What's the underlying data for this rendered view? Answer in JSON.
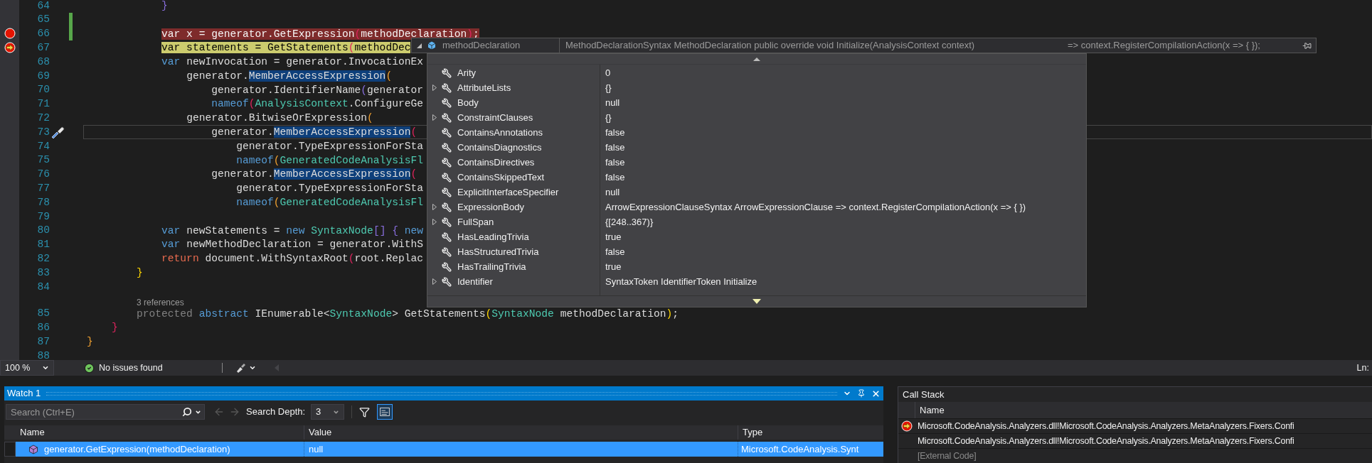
{
  "editor": {
    "lines": [
      {
        "kind": "code",
        "n": "64",
        "changed": false,
        "active": false,
        "tokens": [
          {
            "text": "            }",
            "kind": "b-purple"
          }
        ]
      },
      {
        "kind": "code",
        "n": "65",
        "changed": true,
        "active": false
      },
      {
        "kind": "code",
        "n": "66",
        "changed": true,
        "active": false,
        "glyph": {
          "kind": "breakpoint"
        },
        "tokens": [
          {
            "text": "            var x = generator.GetExpression",
            "kind": "id"
          },
          {
            "text": "(",
            "kind": "b-red"
          },
          {
            "text": "methodDeclaration",
            "kind": "id"
          },
          {
            "text": ")",
            "kind": "b-red"
          },
          {
            "text": ";",
            "kind": "id"
          }
        ]
      },
      {
        "kind": "code",
        "n": "67",
        "changed": false,
        "active": false,
        "glyph": {
          "kind": "current"
        },
        "tokens": [
          {
            "text": "            var statements = GetStatements",
            "kind": "id"
          },
          {
            "text": "(",
            "kind": "b-red"
          },
          {
            "text": "methodDec",
            "kind": "id"
          }
        ]
      },
      {
        "kind": "code",
        "n": "68",
        "changed": false,
        "active": false,
        "tokens": [
          {
            "text": "            var",
            "kind": "kw"
          },
          {
            "text": " newInvocation = generator.InvocationEx",
            "kind": "id"
          }
        ]
      },
      {
        "kind": "code",
        "n": "69",
        "changed": false,
        "active": false,
        "tokens": [
          {
            "text": "                generator.",
            "kind": "id"
          },
          {
            "text": "MemberAccessExpression",
            "kind": "ref"
          },
          {
            "text": "(",
            "kind": "b-orange"
          }
        ]
      },
      {
        "kind": "code",
        "n": "70",
        "changed": false,
        "active": false,
        "tokens": [
          {
            "text": "                    generator.IdentifierName",
            "kind": "id"
          },
          {
            "text": "(",
            "kind": "b-purple"
          },
          {
            "text": "generator",
            "kind": "id"
          }
        ]
      },
      {
        "kind": "code",
        "n": "71",
        "changed": false,
        "active": false,
        "tokens": [
          {
            "text": "                    nameof",
            "kind": "kw"
          },
          {
            "text": "(",
            "kind": "b-red"
          },
          {
            "text": "AnalysisContext",
            "kind": "type"
          },
          {
            "text": ".ConfigureGe",
            "kind": "id"
          }
        ]
      },
      {
        "kind": "code",
        "n": "72",
        "changed": false,
        "active": false,
        "tokens": [
          {
            "text": "                generator.BitwiseOrExpression",
            "kind": "id"
          },
          {
            "text": "(",
            "kind": "b-orange"
          }
        ]
      },
      {
        "kind": "code",
        "n": "73",
        "changed": false,
        "active": true,
        "glyph": {
          "kind": "quick-action"
        },
        "tokens": [
          {
            "text": "                    generator.",
            "kind": "id"
          },
          {
            "text": "MemberAccessExpression",
            "kind": "ref"
          },
          {
            "text": "(",
            "kind": "b-red"
          }
        ]
      },
      {
        "kind": "code",
        "n": "74",
        "changed": false,
        "active": false,
        "tokens": [
          {
            "text": "                        generator.TypeExpressionForSta",
            "kind": "id"
          }
        ]
      },
      {
        "kind": "code",
        "n": "75",
        "changed": false,
        "active": false,
        "tokens": [
          {
            "text": "                        nameof",
            "kind": "kw"
          },
          {
            "text": "(",
            "kind": "b-orange"
          },
          {
            "text": "GeneratedCodeAnalysisFl",
            "kind": "type"
          }
        ]
      },
      {
        "kind": "code",
        "n": "76",
        "changed": false,
        "active": false,
        "tokens": [
          {
            "text": "                    generator.",
            "kind": "id"
          },
          {
            "text": "MemberAccessExpression",
            "kind": "ref"
          },
          {
            "text": "(",
            "kind": "b-red"
          }
        ]
      },
      {
        "kind": "code",
        "n": "77",
        "changed": false,
        "active": false,
        "tokens": [
          {
            "text": "                        generator.TypeExpressionForSta",
            "kind": "id"
          }
        ]
      },
      {
        "kind": "code",
        "n": "78",
        "changed": false,
        "active": false,
        "tokens": [
          {
            "text": "                        nameof",
            "kind": "kw"
          },
          {
            "text": "(",
            "kind": "b-orange"
          },
          {
            "text": "GeneratedCodeAnalysisFl",
            "kind": "type"
          }
        ]
      },
      {
        "kind": "code",
        "n": "79",
        "changed": false,
        "active": false
      },
      {
        "kind": "code",
        "n": "80",
        "changed": false,
        "active": false,
        "tokens": [
          {
            "text": "            var",
            "kind": "kw"
          },
          {
            "text": " newStatements = ",
            "kind": "id"
          },
          {
            "text": "new",
            "kind": "kw"
          },
          {
            "text": " SyntaxNode",
            "kind": "type"
          },
          {
            "text": "[]",
            "kind": "b-purple"
          },
          {
            "text": " {",
            "kind": "b-purple"
          },
          {
            "text": " new",
            "kind": "kw"
          }
        ]
      },
      {
        "kind": "code",
        "n": "81",
        "changed": false,
        "active": false,
        "tokens": [
          {
            "text": "            var",
            "kind": "kw"
          },
          {
            "text": " newMethodDeclaration = generator.WithS",
            "kind": "id"
          }
        ]
      },
      {
        "kind": "code",
        "n": "82",
        "changed": false,
        "active": false,
        "tokens": [
          {
            "text": "            return",
            "kind": "ctl"
          },
          {
            "text": " document.WithSyntaxRoot",
            "kind": "id"
          },
          {
            "text": "(",
            "kind": "b-red"
          },
          {
            "text": "root.Replac",
            "kind": "id"
          }
        ]
      },
      {
        "kind": "code",
        "n": "83",
        "changed": false,
        "active": false,
        "tokens": [
          {
            "text": "        }",
            "kind": "b-gold"
          }
        ]
      },
      {
        "kind": "code",
        "n": "84",
        "changed": false,
        "active": false
      },
      {
        "kind": "codelens",
        "text": "3 references"
      },
      {
        "kind": "code",
        "n": "85",
        "changed": false,
        "active": false,
        "tokens": [
          {
            "text": "        protected",
            "kind": "dim"
          },
          {
            "text": " abstract",
            "kind": "kw"
          },
          {
            "text": " IEnumerable<",
            "kind": "id"
          },
          {
            "text": "SyntaxNode",
            "kind": "type"
          },
          {
            "text": "> GetStatements",
            "kind": "id"
          },
          {
            "text": "(",
            "kind": "b-gold"
          },
          {
            "text": "SyntaxNode",
            "kind": "type"
          },
          {
            "text": " methodDeclaration",
            "kind": "id"
          },
          {
            "text": ")",
            "kind": "b-gold"
          },
          {
            "text": ";",
            "kind": "id"
          }
        ]
      },
      {
        "kind": "code",
        "n": "86",
        "changed": false,
        "active": false,
        "tokens": [
          {
            "text": "    }",
            "kind": "b-red"
          }
        ]
      },
      {
        "kind": "code",
        "n": "87",
        "changed": false,
        "active": false,
        "tokens": [
          {
            "text": "}",
            "kind": "b-orange"
          }
        ]
      },
      {
        "kind": "code",
        "n": "88",
        "changed": false,
        "active": false
      }
    ]
  },
  "datatip": {
    "expanded": true,
    "name": "methodDeclaration",
    "value": "MethodDeclarationSyntax MethodDeclaration public override void Initialize(AnalysisContext context)",
    "extra": "=> context.RegisterCompilationAction(x => { });",
    "rows": [
      {
        "name": "Arity",
        "value": "0",
        "expandable": false
      },
      {
        "name": "AttributeLists",
        "value": "{}",
        "expandable": true
      },
      {
        "name": "Body",
        "value": "null",
        "expandable": false
      },
      {
        "name": "ConstraintClauses",
        "value": "{}",
        "expandable": true
      },
      {
        "name": "ContainsAnnotations",
        "value": "false",
        "expandable": false
      },
      {
        "name": "ContainsDiagnostics",
        "value": "false",
        "expandable": false
      },
      {
        "name": "ContainsDirectives",
        "value": "false",
        "expandable": false
      },
      {
        "name": "ContainsSkippedText",
        "value": "false",
        "expandable": false
      },
      {
        "name": "ExplicitInterfaceSpecifier",
        "value": "null",
        "expandable": false
      },
      {
        "name": "ExpressionBody",
        "value": "ArrowExpressionClauseSyntax ArrowExpressionClause => context.RegisterCompilationAction(x => { })",
        "expandable": true
      },
      {
        "name": "FullSpan",
        "value": "{[248..367)}",
        "expandable": true
      },
      {
        "name": "HasLeadingTrivia",
        "value": "true",
        "expandable": false
      },
      {
        "name": "HasStructuredTrivia",
        "value": "false",
        "expandable": false
      },
      {
        "name": "HasTrailingTrivia",
        "value": "true",
        "expandable": false
      },
      {
        "name": "Identifier",
        "value": "SyntaxToken IdentifierToken Initialize",
        "expandable": true
      }
    ]
  },
  "status_bar": {
    "zoom": "100 %",
    "issues": "No issues found",
    "position": "Ln:"
  },
  "watch": {
    "title": "Watch 1",
    "search_placeholder": "Search (Ctrl+E)",
    "depth_label": "Search Depth:",
    "depth": "3",
    "columns": [
      "Name",
      "Value",
      "Type"
    ],
    "rows": [
      {
        "name": "generator.GetExpression(methodDeclaration)",
        "value": "null",
        "type": "Microsoft.CodeAnalysis.Synt",
        "selected": true
      }
    ]
  },
  "call_stack": {
    "title": "Call Stack",
    "column": "Name",
    "rows": [
      {
        "kind": "frame",
        "text": "Microsoft.CodeAnalysis.Analyzers.dll!Microsoft.CodeAnalysis.Analyzers.MetaAnalyzers.Fixers.Confi",
        "current": true
      },
      {
        "kind": "frame",
        "text": "Microsoft.CodeAnalysis.Analyzers.dll!Microsoft.CodeAnalysis.Analyzers.MetaAnalyzers.Fixers.Confi",
        "current": false
      },
      {
        "kind": "external",
        "text": "[External Code]",
        "current": false
      }
    ]
  }
}
